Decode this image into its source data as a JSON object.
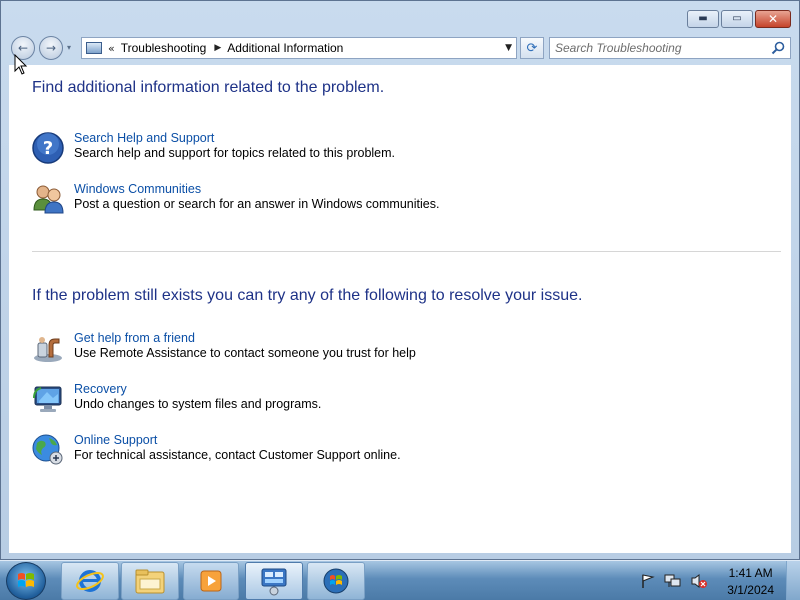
{
  "window": {
    "caption_minimize": "▬",
    "caption_maximize": "▭",
    "caption_close": "✕"
  },
  "nav": {
    "back_glyph": "←",
    "forward_glyph": "→",
    "dropdown_glyph": "▾"
  },
  "address": {
    "chevron": "«",
    "crumbs": [
      "Troubleshooting",
      "Additional Information"
    ],
    "separator": "▶",
    "dropdown_glyph": "▼"
  },
  "refresh_glyph": "⟳",
  "search": {
    "placeholder": "Search Troubleshooting"
  },
  "section1": {
    "heading": "Find additional information related to the problem.",
    "items": [
      {
        "icon": "help-icon",
        "link": "Search Help and Support",
        "description": "Search help and support for topics related to this problem."
      },
      {
        "icon": "communities-icon",
        "link": "Windows Communities",
        "description": "Post a question or search for an answer in Windows communities."
      }
    ]
  },
  "section2": {
    "heading": "If the problem still exists you can try any of the following to resolve your issue.",
    "items": [
      {
        "icon": "remote-assistance-icon",
        "link": "Get help from a friend",
        "description": "Use Remote Assistance to contact someone you trust for help"
      },
      {
        "icon": "recovery-icon",
        "link": "Recovery",
        "description": "Undo changes to system files and programs."
      },
      {
        "icon": "online-support-icon",
        "link": "Online Support",
        "description": "For technical assistance, contact Customer Support online."
      }
    ]
  },
  "taskbar": {
    "pinned": [
      "internet-explorer-icon",
      "windows-explorer-icon",
      "media-player-icon",
      "control-panel-icon",
      "troubleshooting-icon"
    ],
    "clock_time": "1:41 AM",
    "clock_date": "3/1/2024"
  },
  "colors": {
    "heading": "#1e3287",
    "link": "#0b4fa6",
    "frame": "#b8cde4"
  }
}
